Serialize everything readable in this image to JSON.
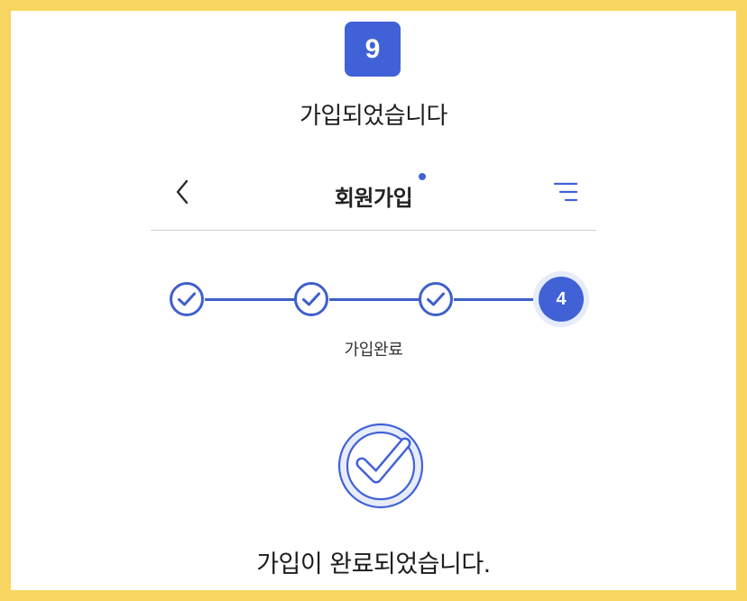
{
  "step_number": "9",
  "caption": "가입되었습니다",
  "header": {
    "title": "회원가입"
  },
  "stepper": {
    "completed_steps": 3,
    "current_step": "4",
    "current_label": "가입완료"
  },
  "message": "가입이 완료되었습니다.",
  "colors": {
    "accent": "#4162d6",
    "background": "#f8d55e"
  },
  "icons": {
    "back": "chevron-left-icon",
    "menu": "menu-icon",
    "step_done": "check-circle-icon",
    "completion": "check-badge-icon"
  }
}
